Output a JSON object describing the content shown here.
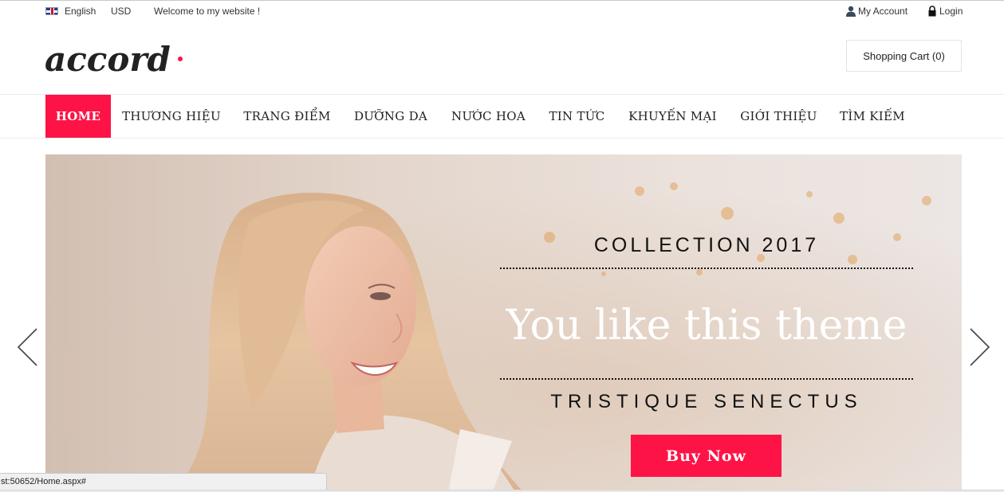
{
  "topbar": {
    "language": "English",
    "currency": "USD",
    "welcome": "Welcome to my website !",
    "my_account": "My Account",
    "login": "Login"
  },
  "header": {
    "logo_text": "accord",
    "cart_label": "Shopping Cart (0)"
  },
  "nav": {
    "items": [
      {
        "label": "HOME",
        "active": true
      },
      {
        "label": "THƯƠNG HIỆU"
      },
      {
        "label": "TRANG ĐIỂM"
      },
      {
        "label": "DƯỠNG DA"
      },
      {
        "label": "NƯỚC HOA"
      },
      {
        "label": "TIN TỨC"
      },
      {
        "label": "KHUYẾN MẠI"
      },
      {
        "label": "GIỚI THIỆU"
      },
      {
        "label": "TÌM KIẾM"
      }
    ]
  },
  "hero": {
    "title": "COLLECTION 2017",
    "headline": "You like this theme",
    "subtitle": "TRISTIQUE SENECTUS",
    "button": "Buy Now"
  },
  "status": {
    "url": "st:50652/Home.aspx#"
  },
  "colors": {
    "accent": "#fe1347",
    "logo_dot": "#fe1347",
    "text_dark": "#222222"
  },
  "icons": {
    "flag": "uk-flag-icon",
    "account": "person-icon",
    "login": "lock-icon",
    "prev": "chevron-left-icon",
    "next": "chevron-right-icon"
  }
}
